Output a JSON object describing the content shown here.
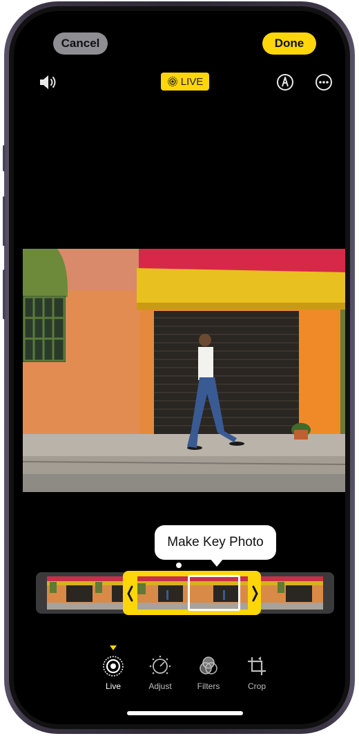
{
  "toolbar": {
    "cancel_label": "Cancel",
    "done_label": "Done",
    "live_badge": "LIVE"
  },
  "tooltip": {
    "text": "Make Key Photo"
  },
  "tabs": [
    {
      "label": "Live",
      "icon": "live-icon",
      "selected": true
    },
    {
      "label": "Adjust",
      "icon": "adjust-dial-icon",
      "selected": false
    },
    {
      "label": "Filters",
      "icon": "filters-icon",
      "selected": false
    },
    {
      "label": "Crop",
      "icon": "crop-icon",
      "selected": false
    }
  ],
  "colors": {
    "accent": "#ffd60a",
    "cancel_bg": "#8e8e93",
    "screen_bg": "#000000"
  }
}
